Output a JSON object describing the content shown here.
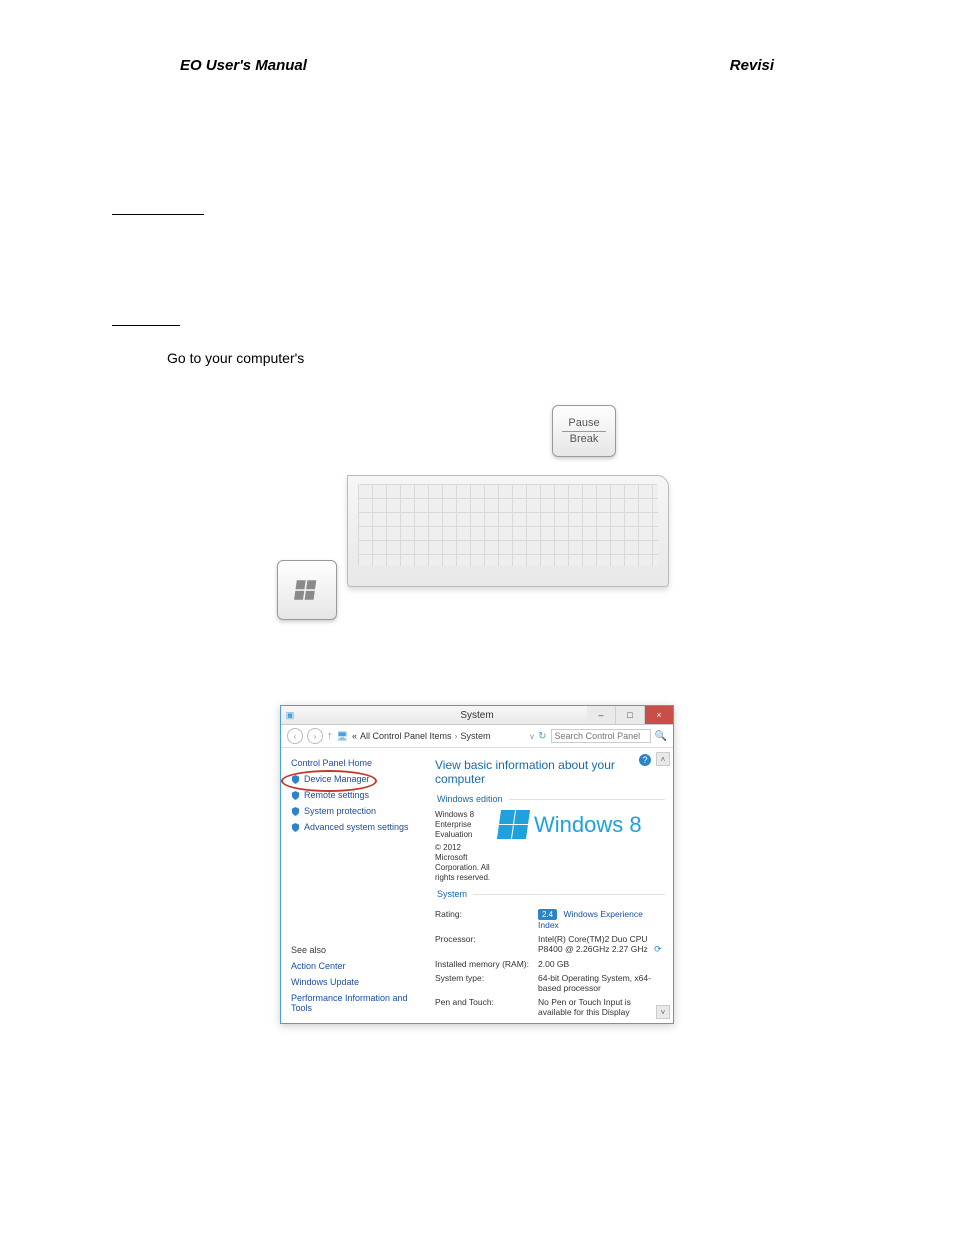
{
  "header": {
    "left": "EO User's Manual",
    "right": "Revisi"
  },
  "step_line": "Go to your computer's",
  "keys": {
    "winlogo_name": "windows-logo",
    "pause_top": "Pause",
    "pause_bottom": "Break"
  },
  "syswin": {
    "title": "System",
    "nav": {
      "back": "‹",
      "fwd": "›",
      "up": "↑",
      "crumb_prefix": "«",
      "crumb1": "All Control Panel Items",
      "crumb_sep": "›",
      "crumb2": "System",
      "dropdown": "v",
      "refresh": "↻",
      "search_placeholder": "Search Control Panel"
    },
    "buttons": {
      "min": "–",
      "max": "□",
      "close": "×"
    },
    "help": "?",
    "scroll_up": "˄",
    "scroll_down": "˅",
    "left": {
      "home": "Control Panel Home",
      "device_manager": "Device Manager",
      "remote": "Remote settings",
      "protection": "System protection",
      "advanced": "Advanced system settings",
      "see_also_label": "See also",
      "action_center": "Action Center",
      "windows_update": "Windows Update",
      "perf_tools": "Performance Information and Tools"
    },
    "right": {
      "heading": "View basic information about your computer",
      "edition_group": "Windows edition",
      "edition_text": "Windows 8 Enterprise Evaluation",
      "copyright_text": "© 2012 Microsoft Corporation. All rights reserved.",
      "winlogo_text": "Windows 8",
      "system_group": "System",
      "rows": {
        "rating_k": "Rating:",
        "rating_badge": "2.4",
        "rating_link": "Windows Experience Index",
        "processor_k": "Processor:",
        "processor_v": "Intel(R) Core(TM)2 Duo CPU    P8400 @ 2.26GHz   2.27 GHz",
        "ram_k": "Installed memory (RAM):",
        "ram_v": "2.00 GB",
        "systype_k": "System type:",
        "systype_v": "64-bit Operating System, x64-based processor",
        "pen_k": "Pen and Touch:",
        "pen_v": "No Pen or Touch Input is available for this Display"
      }
    }
  }
}
